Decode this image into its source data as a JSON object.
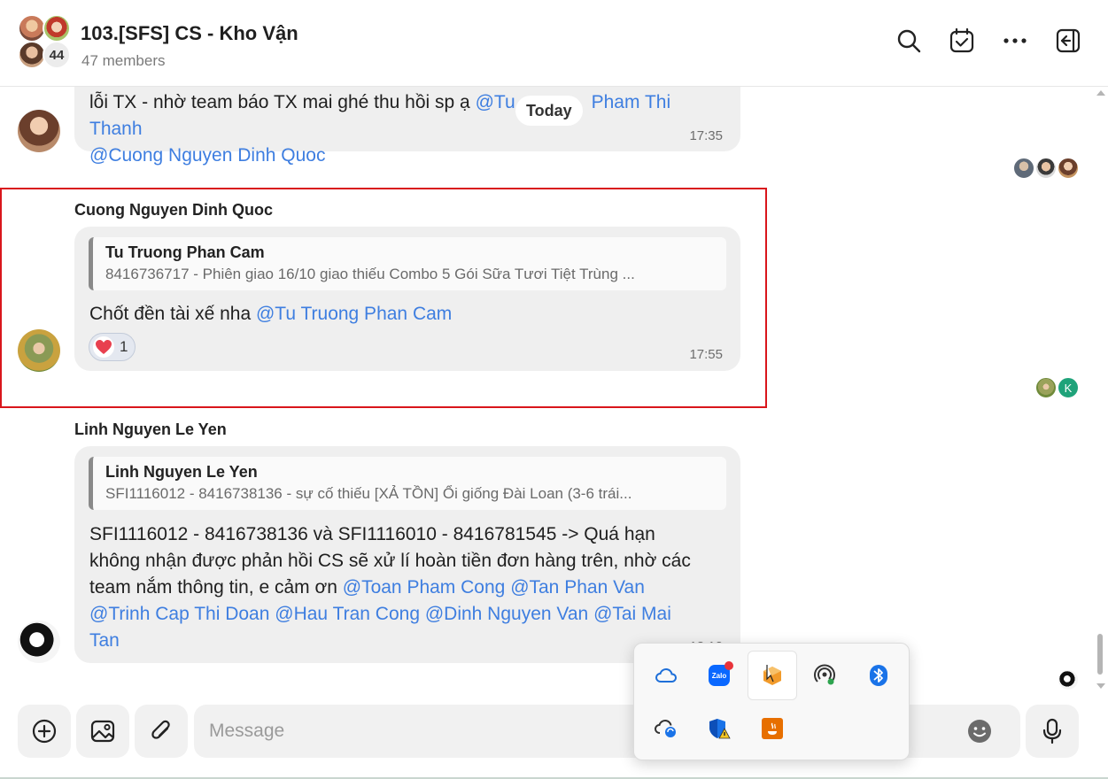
{
  "header": {
    "title": "103.[SFS] CS - Kho Vận",
    "members": "47 members",
    "avatar_count": "44"
  },
  "chat": {
    "today_label": "Today",
    "messages": [
      {
        "text_before": "lỗi TX - nhờ team báo TX mai ghé thu hồi sp ạ ",
        "mention1": "@Tu",
        "mention2": "Pham Thi Thanh",
        "mention3": "@Cuong Nguyen Dinh Quoc",
        "time": "17:35"
      },
      {
        "sender": "Cuong Nguyen Dinh Quoc",
        "quote_name": "Tu Truong Phan Cam",
        "quote_text": "8416736717 - Phiên giao 16/10 giao thiếu Combo 5 Gói Sữa Tươi Tiệt Trùng ...",
        "text_before": "Chốt đền tài xế nha ",
        "mention": "@Tu Truong Phan Cam",
        "reaction_count": "1",
        "time": "17:55"
      },
      {
        "sender": "Linh Nguyen Le Yen",
        "quote_name": "Linh Nguyen Le Yen",
        "quote_text": "SFI1116012 - 8416738136 - sự cố thiếu [XẢ TỒN] Ổi giống Đài Loan (3-6 trái...",
        "line1": "SFI1116012 - 8416738136 và SFI1116010 - 8416781545 -> Quá hạn",
        "line2": "không nhận được phản hồi CS sẽ xử lí hoàn tiền đơn hàng trên, nhờ các",
        "line3_text": "team nắm thông tin, e cảm ơn ",
        "line3_mention1": "@Toan Pham Cong",
        "line3_mention2": "@Tan Phan Van",
        "line4_mention1": "@Trinh Cap Thi Doan",
        "line4_mention2": "@Hau Tran Cong",
        "line4_mention3": "@Dinh Nguyen Van",
        "line4_mention4": "@Tai Mai",
        "line5_mention": "Tan",
        "time": "18:12"
      }
    ],
    "seen_badge_letter": "K"
  },
  "composer": {
    "placeholder": "Message"
  },
  "tray": {
    "zalo_label": "Zalo"
  },
  "colors": {
    "mention": "#3e7ee0",
    "highlight_border": "#d9161c",
    "bubble": "#efefef"
  }
}
